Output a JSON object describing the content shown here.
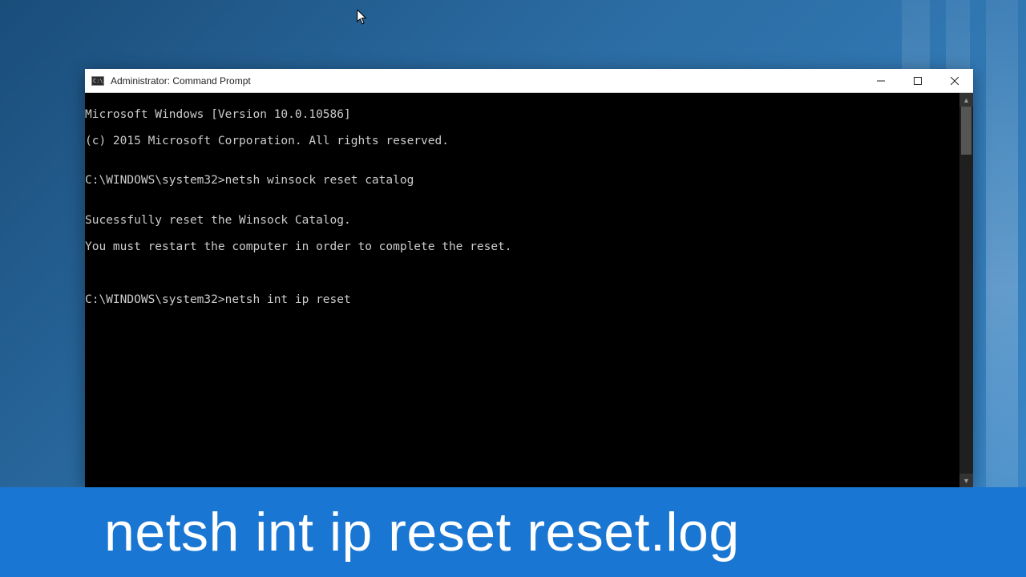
{
  "window": {
    "title": "Administrator: Command Prompt",
    "icon_label": "C:\\"
  },
  "terminal": {
    "lines": [
      "Microsoft Windows [Version 10.0.10586]",
      "(c) 2015 Microsoft Corporation. All rights reserved.",
      "",
      "C:\\WINDOWS\\system32>netsh winsock reset catalog",
      "",
      "Sucessfully reset the Winsock Catalog.",
      "You must restart the computer in order to complete the reset.",
      "",
      "",
      "C:\\WINDOWS\\system32>netsh int ip reset"
    ]
  },
  "caption": {
    "text": "netsh int ip reset reset.log"
  }
}
